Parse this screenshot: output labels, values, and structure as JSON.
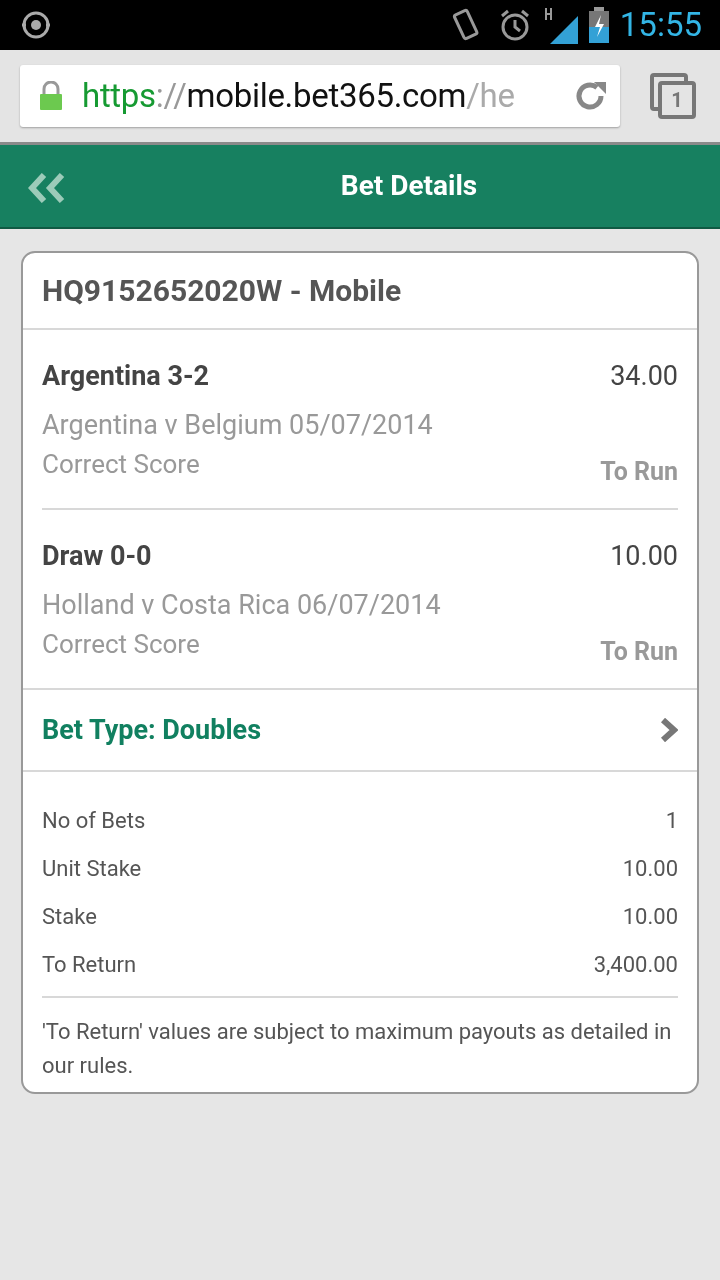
{
  "status_bar": {
    "time": "15:55"
  },
  "browser": {
    "url": [
      {
        "kind": "scheme",
        "text": "https"
      },
      {
        "kind": "sep",
        "text": "://"
      },
      {
        "kind": "host",
        "text": "mobile.bet365.com"
      },
      {
        "kind": "path",
        "text": "/he"
      }
    ],
    "tab_count": "1"
  },
  "header": {
    "title": "Bet Details"
  },
  "bet": {
    "reference": "HQ9152652020W - Mobile",
    "selections": [
      {
        "selection": "Argentina 3-2",
        "odds": "34.00",
        "event": "Argentina v Belgium 05/07/2014",
        "market": "Correct Score",
        "status": "To Run"
      },
      {
        "selection": "Draw 0-0",
        "odds": "10.00",
        "event": "Holland v Costa Rica 06/07/2014",
        "market": "Correct Score",
        "status": "To Run"
      }
    ],
    "bet_type": "Bet Type: Doubles",
    "summary": [
      {
        "label": "No of Bets",
        "value": "1"
      },
      {
        "label": "Unit Stake",
        "value": "10.00"
      },
      {
        "label": "Stake",
        "value": "10.00"
      },
      {
        "label": "To Return",
        "value": "3,400.00"
      }
    ],
    "note": "'To Return' values are subject to maximum payouts as detailed in our rules."
  }
}
